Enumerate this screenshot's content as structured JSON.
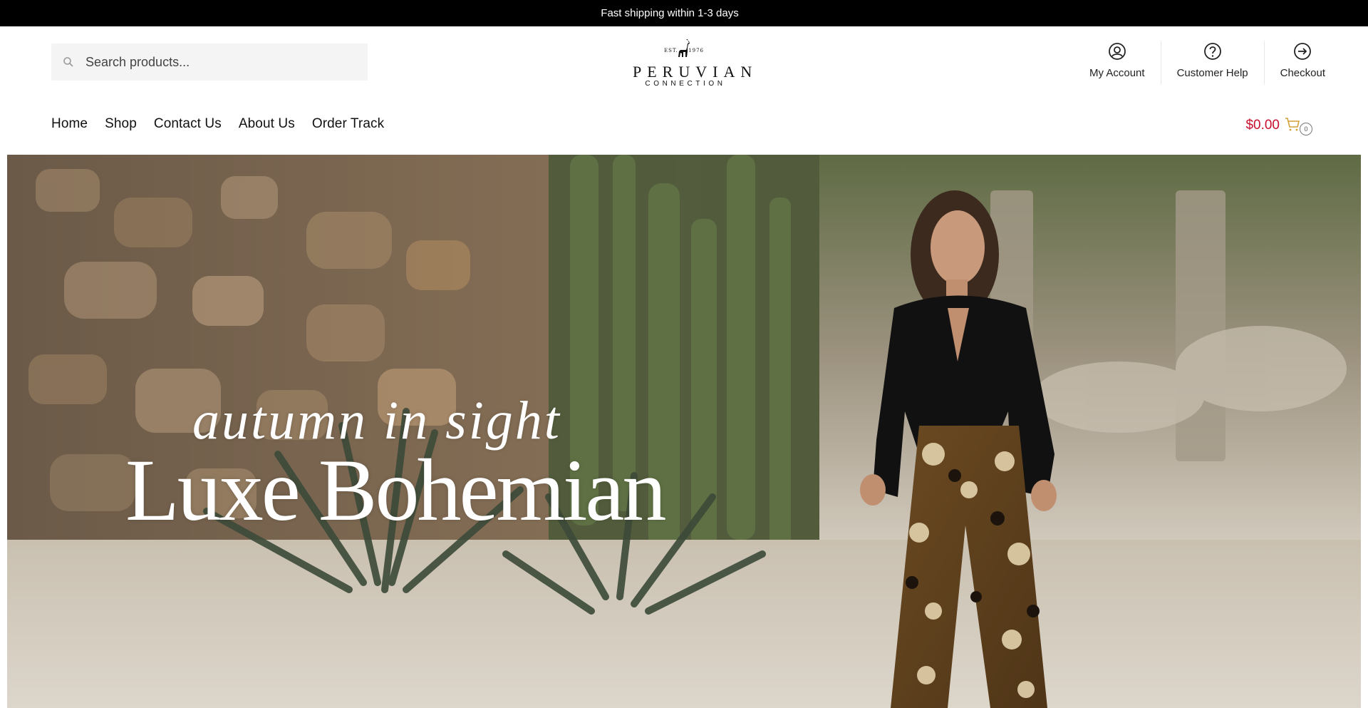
{
  "announcement": "Fast shipping within 1-3 days",
  "search": {
    "placeholder": "Search products..."
  },
  "logo": {
    "est_left": "EST.",
    "est_right": "1976",
    "brand": "PERUVIAN",
    "sub": "CONNECTION"
  },
  "account_links": [
    {
      "label": "My Account",
      "icon": "user-circle-icon"
    },
    {
      "label": "Customer Help",
      "icon": "help-circle-icon"
    },
    {
      "label": "Checkout",
      "icon": "arrow-circle-icon"
    }
  ],
  "nav": [
    "Home",
    "Shop",
    "Contact Us",
    "About Us",
    "Order Track"
  ],
  "cart": {
    "total": "$0.00",
    "count": "0",
    "total_color": "#c8102e"
  },
  "hero": {
    "line1": "autumn in sight",
    "line2": "Luxe Bohemian"
  }
}
